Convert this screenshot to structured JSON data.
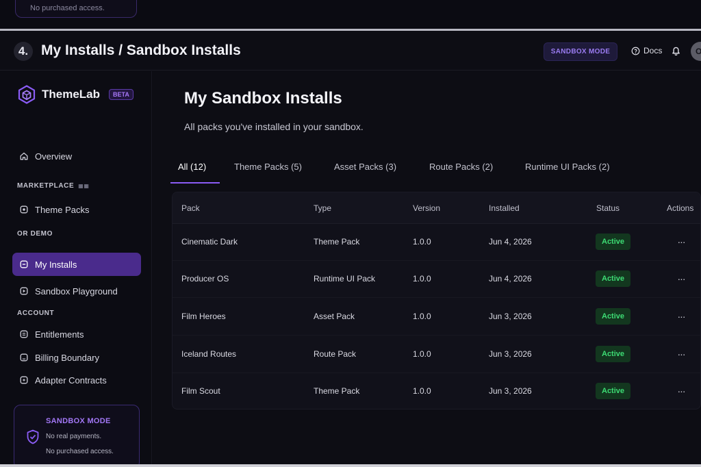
{
  "previous_screen": {
    "card_text": "No purchased access."
  },
  "header": {
    "step": "4.",
    "title": "My Installs / Sandbox Installs",
    "mode_chip": "SANDBOX MODE",
    "docs_label": "Docs",
    "avatar_initial": "O"
  },
  "sidebar": {
    "brand_name": "ThemeLab",
    "beta_label": "BETA",
    "overview_label": "Overview",
    "section_marketplace": "MARKETPLACE",
    "section_marketplace_tag": "▦▦",
    "theme_packs_label": "Theme Packs",
    "section_sandbox": "OR DEMO",
    "my_installs_label": "My Installs",
    "sandbox_playground_label": "Sandbox Playground",
    "section_account": "ACCOUNT",
    "entitlements_label": "Entitlements",
    "billing_label": "Billing Boundary",
    "adapter_label": "Adapter Contracts",
    "card": {
      "title": "SANDBOX MODE",
      "line1": "No real payments.",
      "line2": "No purchased access."
    }
  },
  "main": {
    "title": "My Sandbox Installs",
    "subtitle": "All packs you've installed in your sandbox.",
    "tabs": [
      {
        "label": "All (12)"
      },
      {
        "label": "Theme Packs (5)"
      },
      {
        "label": "Asset Packs (3)"
      },
      {
        "label": "Route Packs (2)"
      },
      {
        "label": "Runtime UI Packs (2)"
      }
    ],
    "columns": [
      "Pack",
      "Type",
      "Version",
      "Installed",
      "Status",
      "Actions"
    ],
    "rows": [
      {
        "pack": "Cinematic Dark",
        "type": "Theme Pack",
        "version": "1.0.0",
        "installed": "Jun 4, 2026",
        "status": "Active",
        "actions": "···"
      },
      {
        "pack": "Producer OS",
        "type": "Runtime UI Pack",
        "version": "1.0.0",
        "installed": "Jun 4, 2026",
        "status": "Active",
        "actions": "···"
      },
      {
        "pack": "Film Heroes",
        "type": "Asset Pack",
        "version": "1.0.0",
        "installed": "Jun 3, 2026",
        "status": "Active",
        "actions": "···"
      },
      {
        "pack": "Iceland Routes",
        "type": "Route Pack",
        "version": "1.0.0",
        "installed": "Jun 3, 2026",
        "status": "Active",
        "actions": "···"
      },
      {
        "pack": "Film Scout",
        "type": "Theme Pack",
        "version": "1.0.0",
        "installed": "Jun 3, 2026",
        "status": "Active",
        "actions": "···"
      }
    ]
  },
  "colors": {
    "accent": "#8b5cf6",
    "active_nav": "#4a2b8c",
    "status_active_bg": "#13371f",
    "status_active_text": "#3ddc74"
  }
}
